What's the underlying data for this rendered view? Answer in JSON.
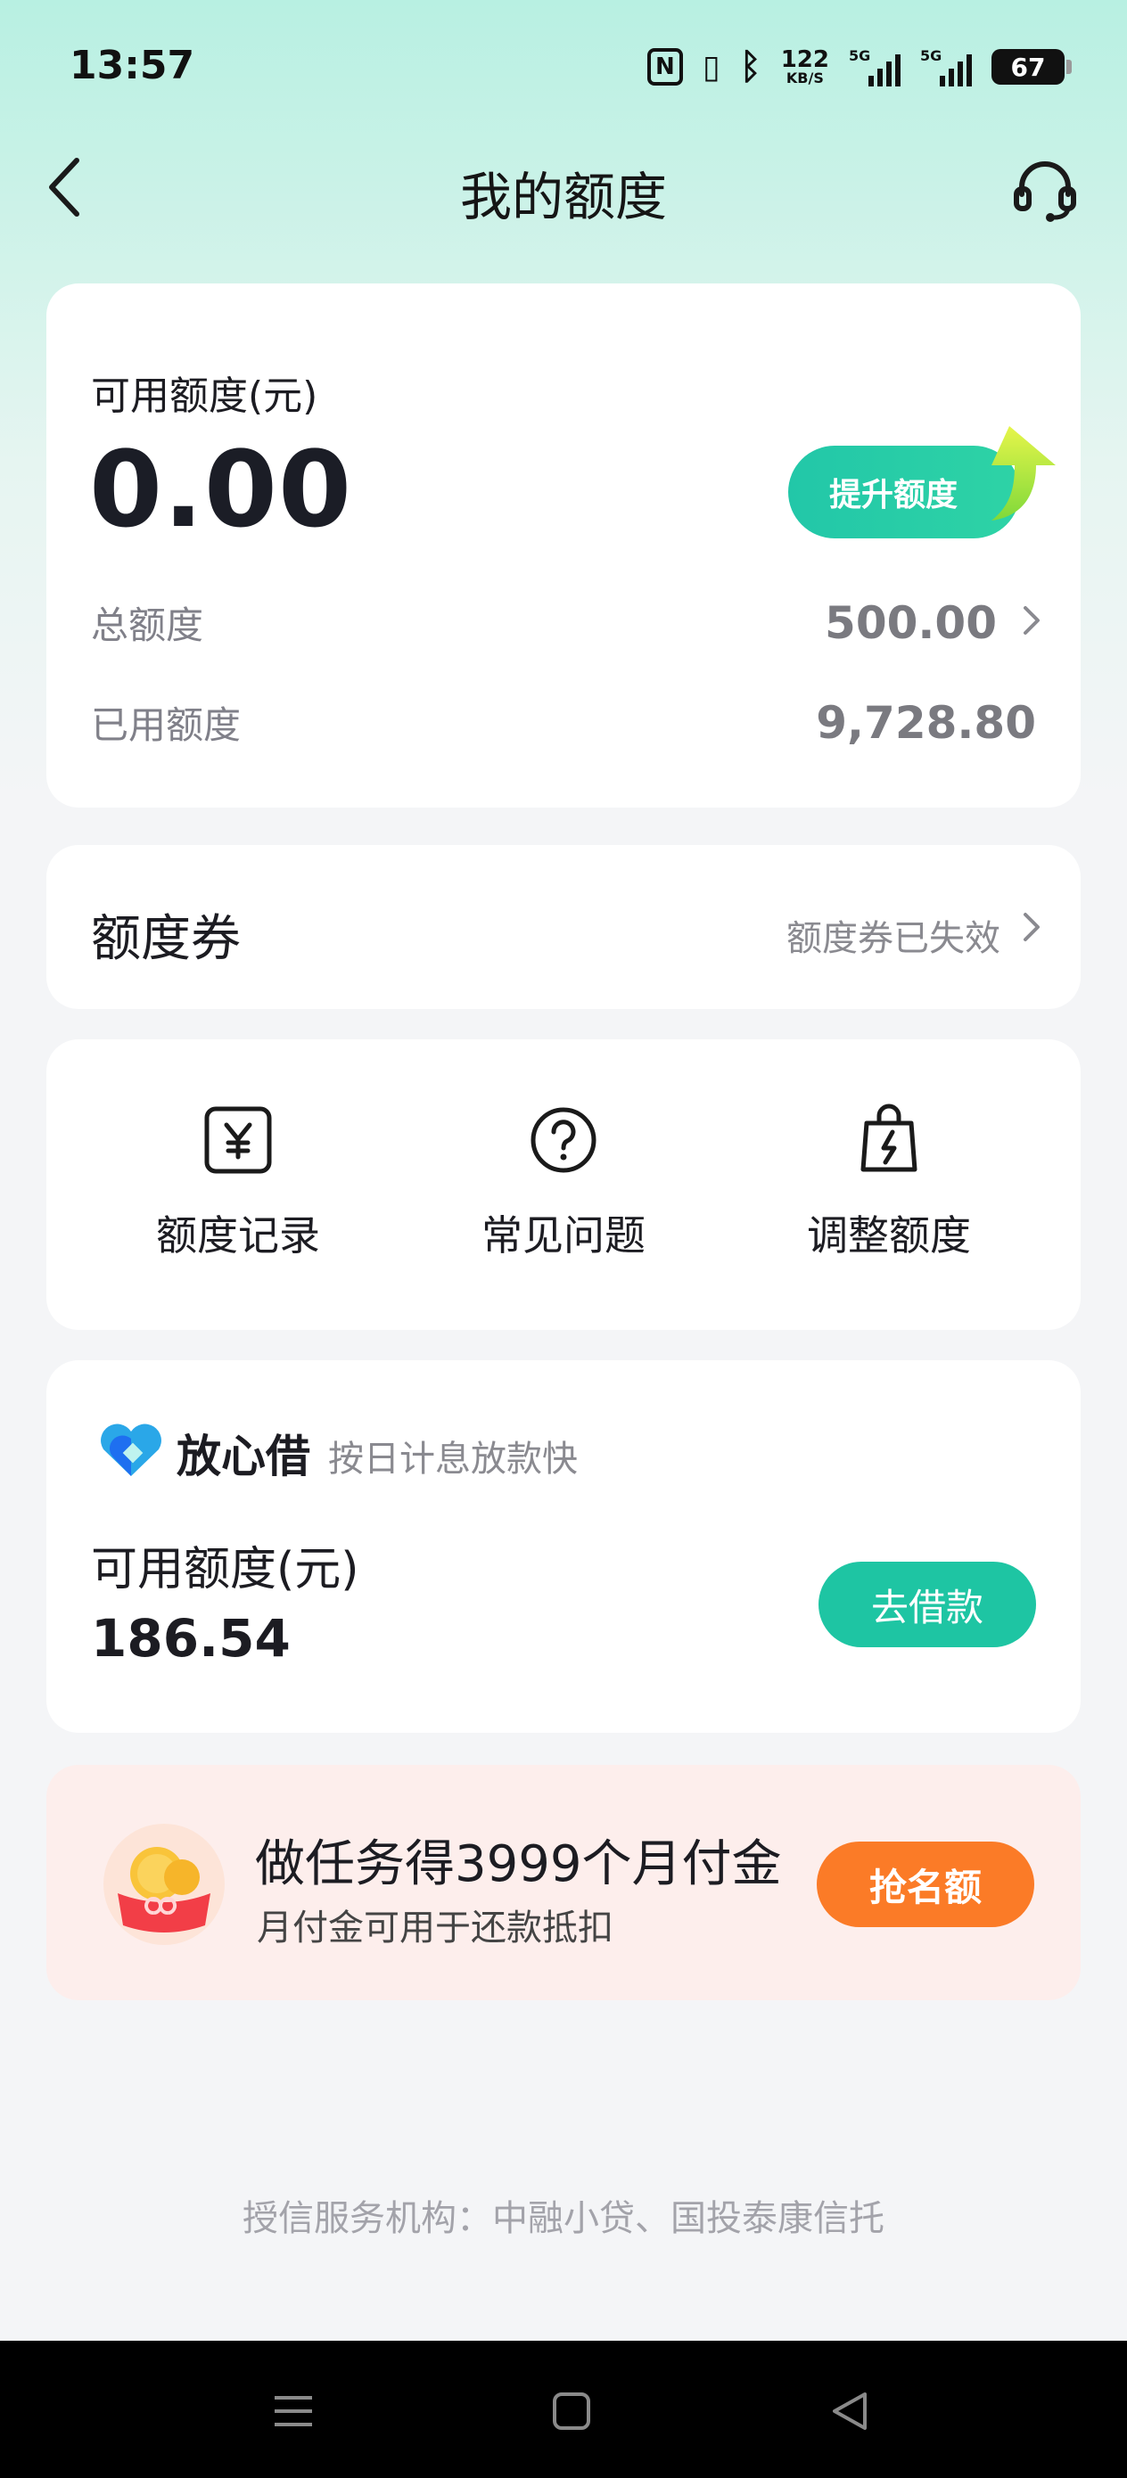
{
  "status_bar": {
    "time": "13:57",
    "nfc_label": "N",
    "network_speed": "122",
    "network_speed_unit": "KB/S",
    "sim1_label": "5G",
    "sim2_label": "5G",
    "battery_level": "67"
  },
  "header": {
    "title": "我的额度"
  },
  "credit_card": {
    "available_label": "可用额度(元)",
    "available_value": "0.00",
    "raise_button": "提升额度",
    "total_label": "总额度",
    "total_value": "500.00",
    "used_label": "已用额度",
    "used_value": "9,728.80"
  },
  "coupon": {
    "title": "额度券",
    "status": "额度券已失效"
  },
  "actions": [
    {
      "label": "额度记录",
      "icon": "yuan-record-icon"
    },
    {
      "label": "常见问题",
      "icon": "question-circle-icon"
    },
    {
      "label": "调整额度",
      "icon": "bag-lightning-icon"
    }
  ],
  "loan": {
    "brand": "放心借",
    "slogan": "按日计息放款快",
    "available_label": "可用额度(元)",
    "available_value": "186.54",
    "button": "去借款"
  },
  "promo": {
    "title": "做任务得3999个月付金",
    "subtitle": "月付金可用于还款抵扣",
    "button": "抢名额"
  },
  "footer": {
    "note": "授信服务机构：中融小贷、国投泰康信托"
  },
  "colors": {
    "accent": "#1ec5a3",
    "promo_button": "#fb7b27",
    "promo_bg": "#fdeeec",
    "header_gradient": "#b8f0e2"
  }
}
